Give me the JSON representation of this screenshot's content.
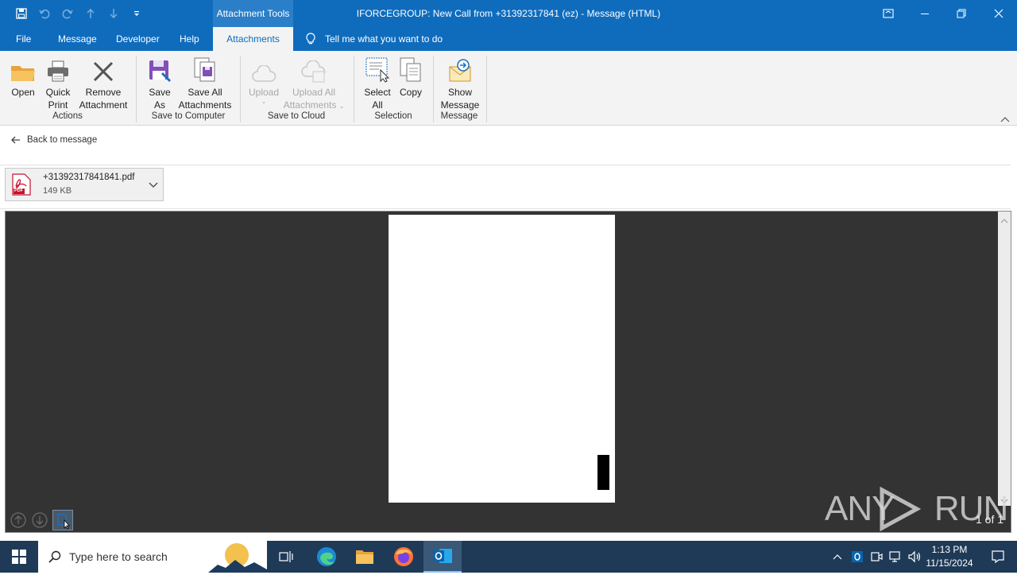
{
  "titlebar": {
    "context_tab": "Attachment Tools",
    "window_title": "IFORCEGROUP: New Call from +31392317841 (ez)  -  Message (HTML)"
  },
  "menu_tabs": [
    "File",
    "Message",
    "Developer",
    "Help",
    "Attachments"
  ],
  "tell_me": "Tell me what you want to do",
  "ribbon": {
    "actions": {
      "open": "Open",
      "quick_print": [
        "Quick",
        "Print"
      ],
      "remove_attachment": [
        "Remove",
        "Attachment"
      ],
      "group": "Actions"
    },
    "save_to_computer": {
      "save_as": [
        "Save",
        "As"
      ],
      "save_all": [
        "Save All",
        "Attachments"
      ],
      "group": "Save to Computer"
    },
    "save_to_cloud": {
      "upload": "Upload",
      "upload_all": [
        "Upload All",
        "Attachments"
      ],
      "group": "Save to Cloud"
    },
    "selection": {
      "select_all": [
        "Select",
        "All"
      ],
      "copy": "Copy",
      "group": "Selection"
    },
    "message": {
      "show_message": [
        "Show",
        "Message"
      ],
      "group": "Message"
    }
  },
  "back_link": "Back to message",
  "attachment": {
    "filename": "+31392317841841.pdf",
    "size": "149 KB",
    "badge": "PDF"
  },
  "preview": {
    "page_count": "1 of 1",
    "watermark": "ANY RUN"
  },
  "taskbar": {
    "search_placeholder": "Type here to search",
    "time": "1:13 PM",
    "date": "11/15/2024"
  },
  "colors": {
    "accent": "#0f6cbd",
    "preview_bg": "#333333",
    "taskbar": "#1f3a57"
  }
}
